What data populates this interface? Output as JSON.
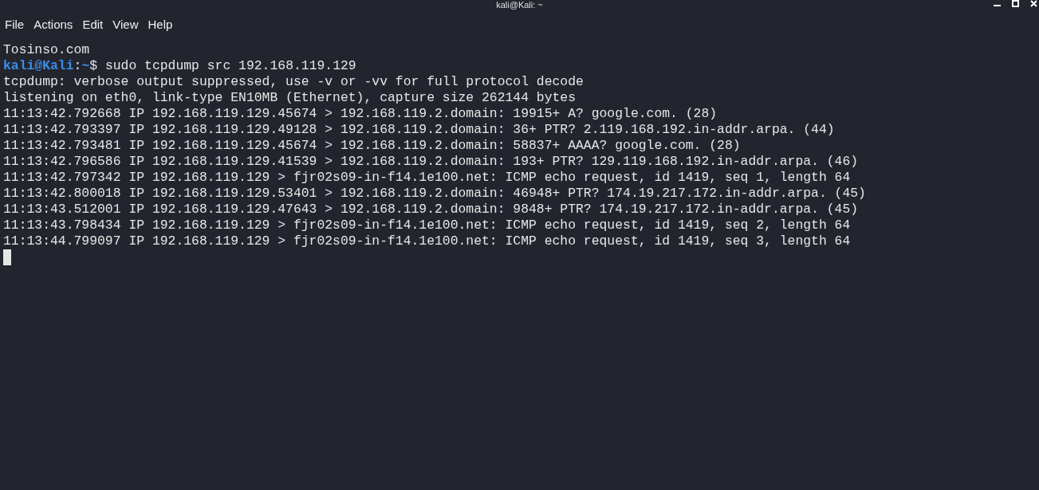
{
  "window": {
    "title": "kali@Kali: ~"
  },
  "menu": [
    "File",
    "Actions",
    "Edit",
    "View",
    "Help"
  ],
  "terminal": {
    "lines": [
      {
        "kind": "output",
        "text": "Tosinso.com"
      },
      {
        "kind": "prompt",
        "user_host": "kali@Kali",
        "separator": ":",
        "path": "~",
        "symbol": "$",
        "command": " sudo tcpdump src 192.168.119.129"
      },
      {
        "kind": "output",
        "text": "tcpdump: verbose output suppressed, use -v or -vv for full protocol decode"
      },
      {
        "kind": "output",
        "text": "listening on eth0, link-type EN10MB (Ethernet), capture size 262144 bytes"
      },
      {
        "kind": "output",
        "text": "11:13:42.792668 IP 192.168.119.129.45674 > 192.168.119.2.domain: 19915+ A? google.com. (28)"
      },
      {
        "kind": "output",
        "text": "11:13:42.793397 IP 192.168.119.129.49128 > 192.168.119.2.domain: 36+ PTR? 2.119.168.192.in-addr.arpa. (44)"
      },
      {
        "kind": "output",
        "text": "11:13:42.793481 IP 192.168.119.129.45674 > 192.168.119.2.domain: 58837+ AAAA? google.com. (28)"
      },
      {
        "kind": "output",
        "text": "11:13:42.796586 IP 192.168.119.129.41539 > 192.168.119.2.domain: 193+ PTR? 129.119.168.192.in-addr.arpa. (46)"
      },
      {
        "kind": "output",
        "text": "11:13:42.797342 IP 192.168.119.129 > fjr02s09-in-f14.1e100.net: ICMP echo request, id 1419, seq 1, length 64"
      },
      {
        "kind": "output",
        "text": "11:13:42.800018 IP 192.168.119.129.53401 > 192.168.119.2.domain: 46948+ PTR? 174.19.217.172.in-addr.arpa. (45)"
      },
      {
        "kind": "output",
        "text": "11:13:43.512001 IP 192.168.119.129.47643 > 192.168.119.2.domain: 9848+ PTR? 174.19.217.172.in-addr.arpa. (45)"
      },
      {
        "kind": "output",
        "text": "11:13:43.798434 IP 192.168.119.129 > fjr02s09-in-f14.1e100.net: ICMP echo request, id 1419, seq 2, length 64"
      },
      {
        "kind": "output",
        "text": "11:13:44.799097 IP 192.168.119.129 > fjr02s09-in-f14.1e100.net: ICMP echo request, id 1419, seq 3, length 64"
      },
      {
        "kind": "cursor"
      }
    ]
  }
}
